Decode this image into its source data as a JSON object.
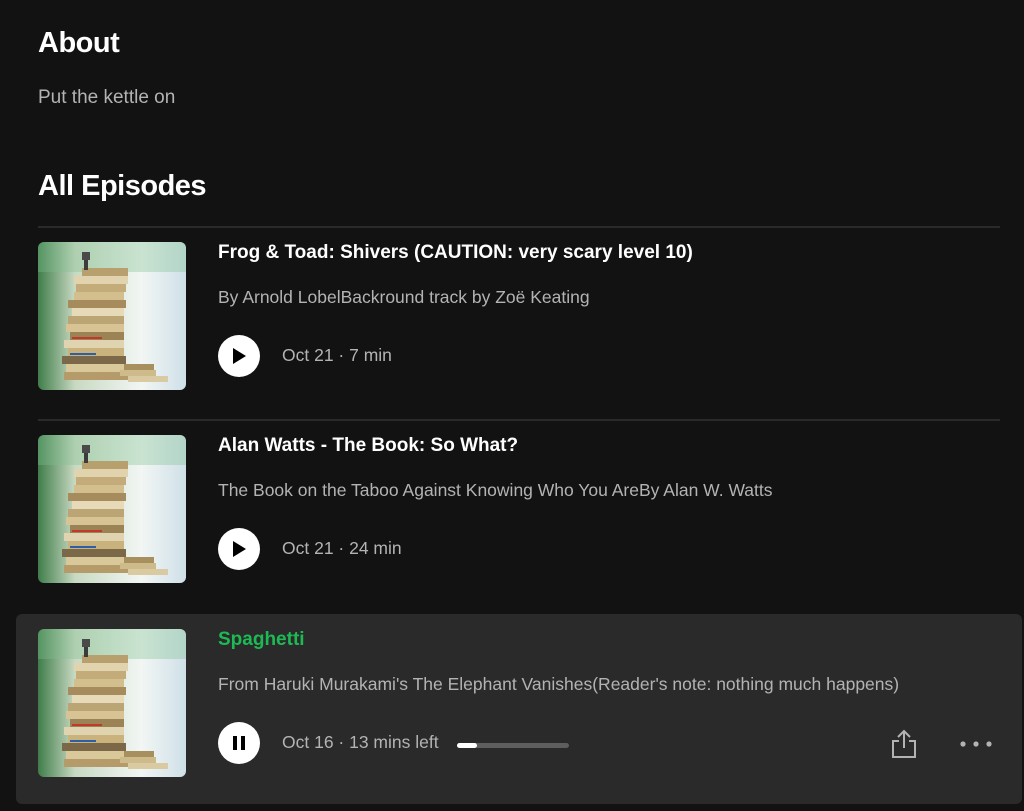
{
  "about": {
    "title": "About",
    "description": "Put the kettle on"
  },
  "episodes_section": {
    "title": "All Episodes"
  },
  "episodes": [
    {
      "title": "Frog & Toad: Shivers (CAUTION: very scary level 10)",
      "description": "By Arnold LobelBackround track by Zoë Keating",
      "meta": "Oct 21 · 7 min",
      "state": "paused"
    },
    {
      "title": "Alan Watts - The Book: So What?",
      "description": "The Book on the Taboo Against Knowing Who You AreBy Alan W. Watts",
      "meta": "Oct 21 · 24 min",
      "state": "paused"
    },
    {
      "title": "Spaghetti",
      "description": "From Haruki Murakami's The Elephant Vanishes(Reader's note: nothing much happens)",
      "meta": "Oct 16 · 13 mins left",
      "state": "playing",
      "progress": 0.18
    }
  ],
  "icons": {
    "play": "play-icon",
    "pause": "pause-icon",
    "share": "share-icon",
    "more": "more-options-icon"
  },
  "colors": {
    "background": "#121212",
    "active_row": "#2a2a2a",
    "accent": "#1db954",
    "secondary_text": "#b3b3b3"
  }
}
